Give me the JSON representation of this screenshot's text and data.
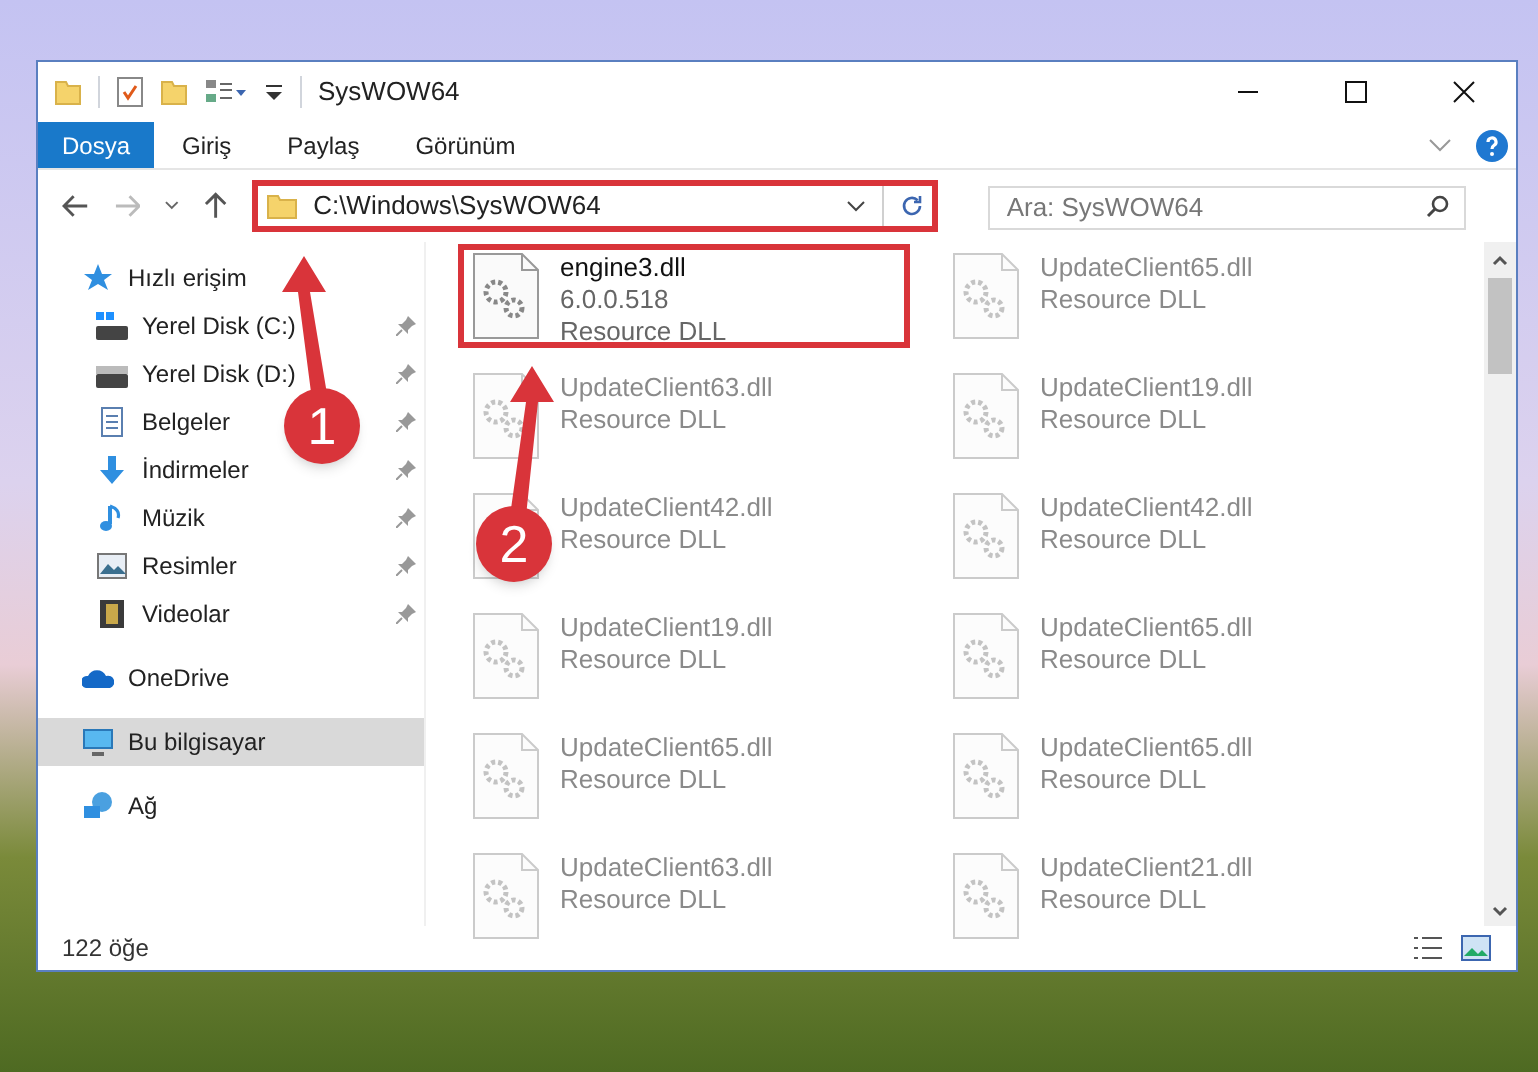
{
  "window": {
    "title": "SysWOW64"
  },
  "ribbon_tabs": [
    {
      "label": "Dosya",
      "selected": true
    },
    {
      "label": "Giriş",
      "selected": false
    },
    {
      "label": "Paylaş",
      "selected": false
    },
    {
      "label": "Görünüm",
      "selected": false
    }
  ],
  "address": {
    "path": "C:\\Windows\\SysWOW64",
    "highlighted": true
  },
  "search": {
    "placeholder": "Ara: SysWOW64"
  },
  "sidebar": {
    "items": [
      {
        "label": "Hızlı erişim",
        "kind": "quick",
        "selected": false,
        "children": [
          {
            "label": "Yerel Disk (C:)",
            "kind": "drive-c",
            "pinned": true,
            "selected": false
          },
          {
            "label": "Yerel Disk (D:)",
            "kind": "drive",
            "pinned": true,
            "selected": false
          },
          {
            "label": "Belgeler",
            "kind": "documents",
            "pinned": true,
            "selected": false
          },
          {
            "label": "İndirmeler",
            "kind": "downloads",
            "pinned": true,
            "selected": false
          },
          {
            "label": "Müzik",
            "kind": "music",
            "pinned": true,
            "selected": false
          },
          {
            "label": "Resimler",
            "kind": "pictures",
            "pinned": true,
            "selected": false
          },
          {
            "label": "Videolar",
            "kind": "videos",
            "pinned": true,
            "selected": false
          }
        ]
      },
      {
        "label": "OneDrive",
        "kind": "onedrive",
        "selected": false
      },
      {
        "label": "Bu bilgisayar",
        "kind": "pc",
        "selected": true
      },
      {
        "label": "Ağ",
        "kind": "network",
        "selected": false
      }
    ]
  },
  "files": [
    {
      "name": "engine3.dll",
      "version": "6.0.0.518",
      "type": "Resource DLL",
      "highlighted": true,
      "blurred": false
    },
    {
      "name": "UpdateClient65.dll",
      "type": "Resource DLL",
      "highlighted": false,
      "blurred": true
    },
    {
      "name": "UpdateClient63.dll",
      "type": "Resource DLL",
      "highlighted": false,
      "blurred": true
    },
    {
      "name": "UpdateClient19.dll",
      "type": "Resource DLL",
      "highlighted": false,
      "blurred": true
    },
    {
      "name": "UpdateClient42.dll",
      "type": "Resource DLL",
      "highlighted": false,
      "blurred": true
    },
    {
      "name": "UpdateClient42.dll",
      "type": "Resource DLL",
      "highlighted": false,
      "blurred": true
    },
    {
      "name": "UpdateClient19.dll",
      "type": "Resource DLL",
      "highlighted": false,
      "blurred": true
    },
    {
      "name": "UpdateClient65.dll",
      "type": "Resource DLL",
      "highlighted": false,
      "blurred": true
    },
    {
      "name": "UpdateClient65.dll",
      "type": "Resource DLL",
      "highlighted": false,
      "blurred": true
    },
    {
      "name": "UpdateClient65.dll",
      "type": "Resource DLL",
      "highlighted": false,
      "blurred": true
    },
    {
      "name": "UpdateClient63.dll",
      "type": "Resource DLL",
      "highlighted": false,
      "blurred": true
    },
    {
      "name": "UpdateClient21.dll",
      "type": "Resource DLL",
      "highlighted": false,
      "blurred": true
    }
  ],
  "status_bar": {
    "count": "122 öğe"
  },
  "annotations": [
    {
      "label": "1"
    },
    {
      "label": "2"
    }
  ]
}
